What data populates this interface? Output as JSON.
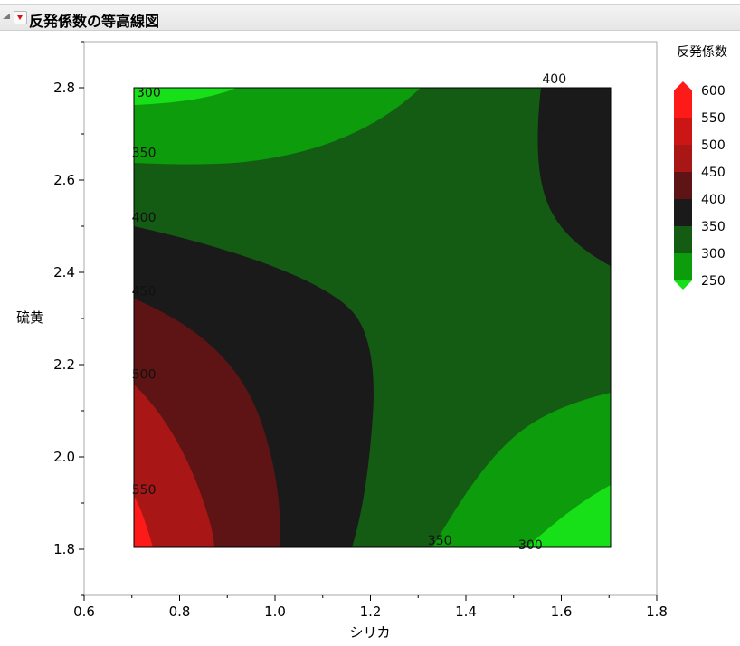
{
  "header": {
    "title": "反発係数の等高線図"
  },
  "chart_data": {
    "type": "contour",
    "xlabel": "シリカ",
    "ylabel": "硫黄",
    "xlim": [
      0.6,
      1.8
    ],
    "ylim": [
      1.7,
      2.9
    ],
    "xticks": [
      0.6,
      0.8,
      1.0,
      1.2,
      1.4,
      1.6,
      1.8
    ],
    "yticks": [
      1.8,
      2.0,
      2.2,
      2.4,
      2.6,
      2.8
    ],
    "plot_region": {
      "x": [
        0.7,
        1.7
      ],
      "y": [
        1.8,
        2.8
      ]
    },
    "levels": [
      250,
      300,
      350,
      400,
      450,
      500,
      550,
      600
    ],
    "legend": {
      "title": "反発係数",
      "position": "right",
      "labels": [
        "600",
        "550",
        "500",
        "450",
        "400",
        "350",
        "300",
        "250"
      ],
      "colors": [
        "#ff1a1a",
        "#cc1616",
        "#a81616",
        "#5e1414",
        "#1a1a1a",
        "#145c14",
        "#0c9c0c",
        "#18e018"
      ]
    },
    "contour_labels": [
      {
        "text": "300",
        "x": 0.71,
        "y": 2.78
      },
      {
        "text": "350",
        "x": 0.7,
        "y": 2.65
      },
      {
        "text": "400",
        "x": 0.7,
        "y": 2.51
      },
      {
        "text": "450",
        "x": 0.7,
        "y": 2.35
      },
      {
        "text": "500",
        "x": 0.7,
        "y": 2.17
      },
      {
        "text": "550",
        "x": 0.7,
        "y": 1.92
      },
      {
        "text": "400",
        "x": 1.56,
        "y": 2.81
      },
      {
        "text": "350",
        "x": 1.32,
        "y": 1.81
      },
      {
        "text": "300",
        "x": 1.51,
        "y": 1.8
      }
    ]
  }
}
